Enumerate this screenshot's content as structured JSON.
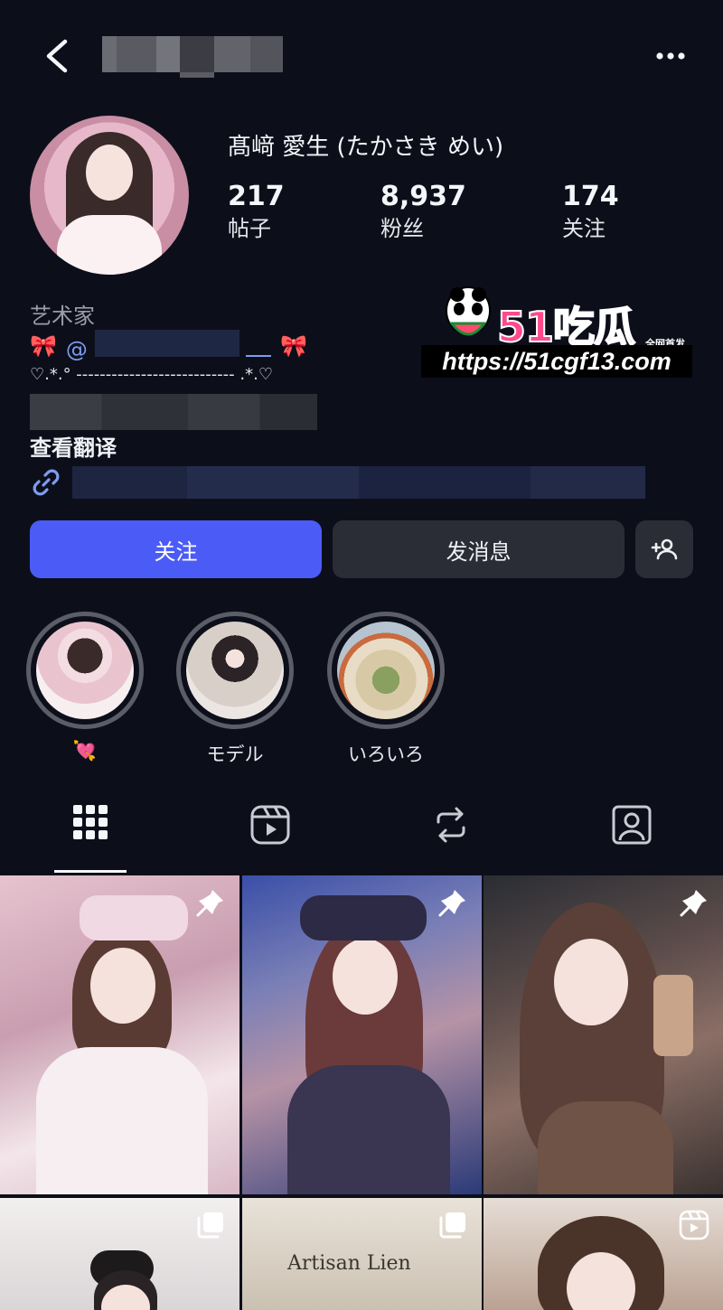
{
  "header": {
    "back_icon": "chevron-left-icon",
    "more_icon": "more-horizontal-icon"
  },
  "profile": {
    "display_name": "髙﨑 愛生 (たかさき めい)",
    "stats": [
      {
        "value": "217",
        "label": "帖子"
      },
      {
        "value": "8,937",
        "label": "粉丝"
      },
      {
        "value": "174",
        "label": "关注"
      }
    ],
    "category": "艺术家",
    "bio_mention_prefix": "@",
    "bio_emoji_left": "🎀",
    "bio_emoji_right": "🎀",
    "bio_line2": "♡.*.° --------------------------- .*.♡",
    "translate_label": "查看翻译",
    "link_icon": "link-icon"
  },
  "watermark": {
    "brand": "51吃瓜",
    "tag": "全网首发",
    "url": "https://51cgf13.com"
  },
  "actions": {
    "follow_label": "关注",
    "message_label": "发消息",
    "add_user_icon": "add-person-icon"
  },
  "highlights": [
    {
      "label": "💘"
    },
    {
      "label": "モデル"
    },
    {
      "label": "いろいろ"
    }
  ],
  "tabs": [
    {
      "name": "posts",
      "icon": "grid-icon",
      "active": true
    },
    {
      "name": "reels",
      "icon": "reels-icon",
      "active": false
    },
    {
      "name": "reposts",
      "icon": "repost-icon",
      "active": false
    },
    {
      "name": "tagged",
      "icon": "tagged-icon",
      "active": false
    }
  ],
  "posts": [
    {
      "badge": "pin-icon"
    },
    {
      "badge": "pin-icon"
    },
    {
      "badge": "pin-icon"
    },
    {
      "badge": "carousel-icon"
    },
    {
      "badge": "carousel-icon",
      "sign_text": "Artisan Lien"
    },
    {
      "badge": "reels-icon"
    }
  ],
  "colors": {
    "background": "#0c0f1a",
    "follow_button": "#4b5cf6",
    "secondary_button": "#2a2d35",
    "mention": "#7d9cf0",
    "category": "#9a9ca6"
  }
}
